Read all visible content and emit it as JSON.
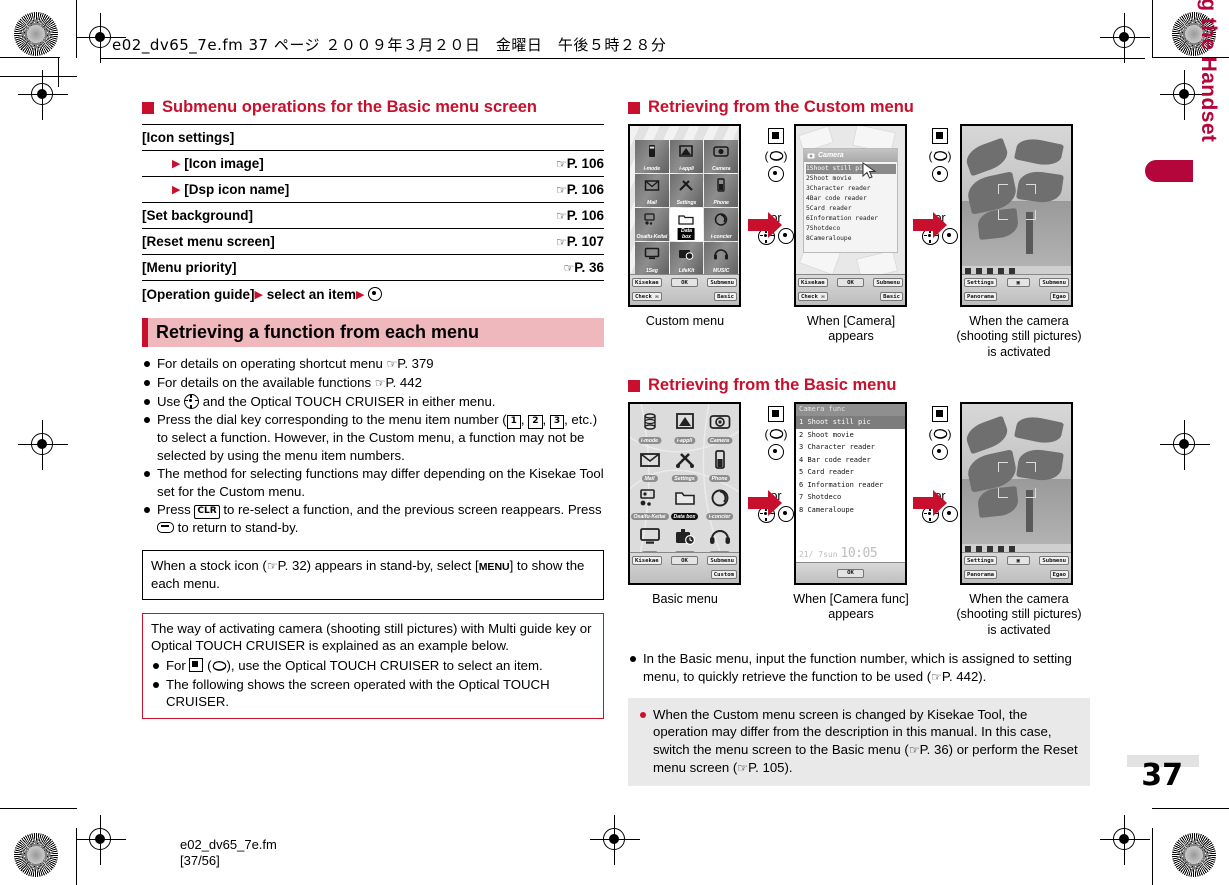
{
  "header": {
    "print_line": "e02_dv65_7e.fm  37 ページ  ２００９年３月２０日　金曜日　午後５時２８分"
  },
  "side": {
    "chapter_title": "Before Using the Handset",
    "page_number": "37"
  },
  "footer": {
    "filename": "e02_dv65_7e.fm",
    "pagecount": "[37/56]"
  },
  "left": {
    "submenu_heading": "Submenu operations for the Basic menu screen",
    "submenu_rows": [
      {
        "label": "[Icon settings]",
        "ref": "",
        "indent": 0
      },
      {
        "label": "[Icon image]",
        "ref": "P. 106",
        "indent": 1
      },
      {
        "label": "[Dsp icon name]",
        "ref": "P. 106",
        "indent": 1
      },
      {
        "label": "[Set background]",
        "ref": "P. 106",
        "indent": 0
      },
      {
        "label": "[Reset menu screen]",
        "ref": "P. 107",
        "indent": 0
      },
      {
        "label": "[Menu priority]",
        "ref": "P. 36",
        "indent": 0
      }
    ],
    "operation_guide": {
      "part1": "[Operation guide]",
      "part2": "select an item",
      "part3": ""
    },
    "band_title": "Retrieving a function from each menu",
    "bullets": [
      {
        "id": "b1",
        "text": "For details on operating shortcut menu ☞P. 379"
      },
      {
        "id": "b2",
        "text": "For details on the available functions ☞P. 442"
      },
      {
        "id": "b3",
        "text": "Use ✥ and the Optical TOUCH CRUISER in either menu."
      },
      {
        "id": "b4",
        "text": "Press the dial key corresponding to the menu item number (1, 2, 3, etc.) to select a function. However, in the Custom menu, a function may not be selected by using the menu item numbers."
      },
      {
        "id": "b5",
        "text": "The method for selecting functions may differ depending on the Kisekae Tool set for the Custom menu."
      },
      {
        "id": "b6",
        "text": "Press CLR to re-select a function, and the previous screen reappears. Press ⌒ to return to stand-by."
      }
    ],
    "note_box": "When a stock icon (☞P. 32) appears in stand-by, select [MENU] to show the each menu.",
    "note_box_menu_key": "MENU",
    "red_box": {
      "intro": "The way of activating camera (shooting still pictures) with Multi guide key or Optical TOUCH CRUISER is explained as an example below.",
      "items": [
        "For ■ (✇), use the Optical TOUCH CRUISER to select an item.",
        "The following shows the screen operated with the Optical TOUCH CRUISER."
      ]
    }
  },
  "right": {
    "custom_heading": "Retrieving from the Custom menu",
    "basic_heading": "Retrieving from the Basic menu",
    "captions_custom": [
      "Custom menu",
      "When [Camera] appears",
      "When the camera (shooting still pictures) is activated"
    ],
    "captions_basic": [
      "Basic menu",
      "When [Camera func] appears",
      "When the camera (shooting still pictures) is activated"
    ],
    "or_label": "or",
    "bullet_basic": "In the Basic menu, input the function number, which is assigned to setting menu, to quickly retrieve the function to be used (☞P. 442).",
    "gray_note": "When the Custom menu screen is changed by Kisekae Tool, the operation may differ from the description in this manual. In this case, switch the menu screen to the Basic menu (☞P. 36) or perform the Reset menu screen (☞P. 105)."
  },
  "phone": {
    "menu_grid": [
      {
        "label": "i-mode",
        "icon": "imode-icon"
      },
      {
        "label": "i-appli",
        "icon": "iappli-icon"
      },
      {
        "label": "Camera",
        "icon": "camera-icon"
      },
      {
        "label": "Mail",
        "icon": "mail-icon"
      },
      {
        "label": "Settings",
        "icon": "settings-icon"
      },
      {
        "label": "Phone",
        "icon": "phone-icon"
      },
      {
        "label": "Osaifu-Keitai",
        "icon": "osaifu-icon"
      },
      {
        "label": "Data box",
        "icon": "databox-icon",
        "selected": true
      },
      {
        "label": "i-concier",
        "icon": "iconcier-icon"
      },
      {
        "label": "1Seg",
        "icon": "oneseg-icon"
      },
      {
        "label": "LifeKit",
        "icon": "lifekit-icon"
      },
      {
        "label": "MUSIC",
        "icon": "music-icon"
      }
    ],
    "softkeys_custom": {
      "top_left": "Kisekae",
      "top_mid": "OK",
      "top_right": "Submenu",
      "bot_left": "Check ✉",
      "bot_right": "Basic"
    },
    "softkeys_basic": {
      "top_left": "Kisekae",
      "top_mid": "OK",
      "top_right": "Submenu",
      "bot_right": "Custom"
    },
    "camera_popup_title": "Camera",
    "camera_list": [
      {
        "num": "1",
        "label": "Shoot still pic",
        "selected": true
      },
      {
        "num": "2",
        "label": "Shoot movie"
      },
      {
        "num": "3",
        "label": "Character reader"
      },
      {
        "num": "4",
        "label": "Bar code reader"
      },
      {
        "num": "5",
        "label": "Card reader"
      },
      {
        "num": "6",
        "label": "Information reader"
      },
      {
        "num": "7",
        "label": "Shotdeco"
      },
      {
        "num": "8",
        "label": "Cameraloupe"
      }
    ],
    "camera_func_title": "Camera func",
    "basic_clock": {
      "date": "21/  7sun",
      "time": "10:05"
    },
    "basic_ok": "OK",
    "camera_softkeys": {
      "top_left": "Settings",
      "top_right": "Submenu",
      "bot_left": "Panorama",
      "bot_right": "Egao",
      "mid": "📷"
    }
  }
}
